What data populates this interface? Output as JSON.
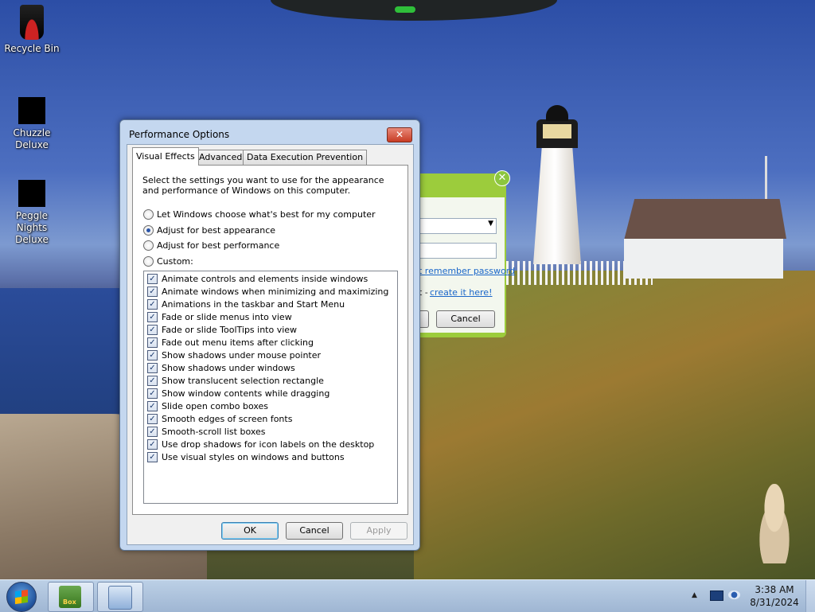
{
  "desktop": {
    "icons": [
      {
        "label": "Recycle Bin",
        "icon": "recycle-bin-icon"
      },
      {
        "label": "Chuzzle Deluxe",
        "icon": "chuzzle-icon"
      },
      {
        "label": "Peggle Nights Deluxe",
        "icon": "peggle-icon"
      }
    ]
  },
  "background_dialog": {
    "close_glyph": "✕",
    "forgot_link": "t remember password",
    "create_prefix": "t -",
    "create_link": "create it here!",
    "cancel_label": "Cancel"
  },
  "window": {
    "title": "Performance Options",
    "close_glyph": "✕",
    "tabs": [
      "Visual Effects",
      "Advanced",
      "Data Execution Prevention"
    ],
    "active_tab": "Visual Effects",
    "description": "Select the settings you want to use for the appearance and performance of Windows on this computer.",
    "radios": [
      {
        "label": "Let Windows choose what's best for my computer",
        "selected": false
      },
      {
        "label": "Adjust for best appearance",
        "selected": true
      },
      {
        "label": "Adjust for best performance",
        "selected": false
      },
      {
        "label": "Custom:",
        "selected": false
      }
    ],
    "effects": [
      {
        "label": "Animate controls and elements inside windows",
        "checked": true
      },
      {
        "label": "Animate windows when minimizing and maximizing",
        "checked": true
      },
      {
        "label": "Animations in the taskbar and Start Menu",
        "checked": true
      },
      {
        "label": "Fade or slide menus into view",
        "checked": true
      },
      {
        "label": "Fade or slide ToolTips into view",
        "checked": true
      },
      {
        "label": "Fade out menu items after clicking",
        "checked": true
      },
      {
        "label": "Show shadows under mouse pointer",
        "checked": true
      },
      {
        "label": "Show shadows under windows",
        "checked": true
      },
      {
        "label": "Show translucent selection rectangle",
        "checked": true
      },
      {
        "label": "Show window contents while dragging",
        "checked": true
      },
      {
        "label": "Slide open combo boxes",
        "checked": true
      },
      {
        "label": "Smooth edges of screen fonts",
        "checked": true
      },
      {
        "label": "Smooth-scroll list boxes",
        "checked": true
      },
      {
        "label": "Use drop shadows for icon labels on the desktop",
        "checked": true
      },
      {
        "label": "Use visual styles on windows and buttons",
        "checked": true
      }
    ],
    "buttons": {
      "ok": "OK",
      "cancel": "Cancel",
      "apply": "Apply"
    }
  },
  "taskbar": {
    "start_icon": "windows-start-icon",
    "items": [
      {
        "icon": "game-box-icon",
        "label": "Box"
      },
      {
        "icon": "system-properties-icon"
      }
    ],
    "tray": {
      "show_hidden": "▲",
      "icons": [
        "action-center-icon",
        "network-icon"
      ]
    },
    "clock": {
      "time": "3:38 AM",
      "date": "8/31/2024"
    }
  },
  "colors": {
    "window_frame": "#c4d7ef",
    "close_red": "#c83c24",
    "link_blue": "#1a66c9",
    "dialog_green": "#9ccc3c"
  }
}
